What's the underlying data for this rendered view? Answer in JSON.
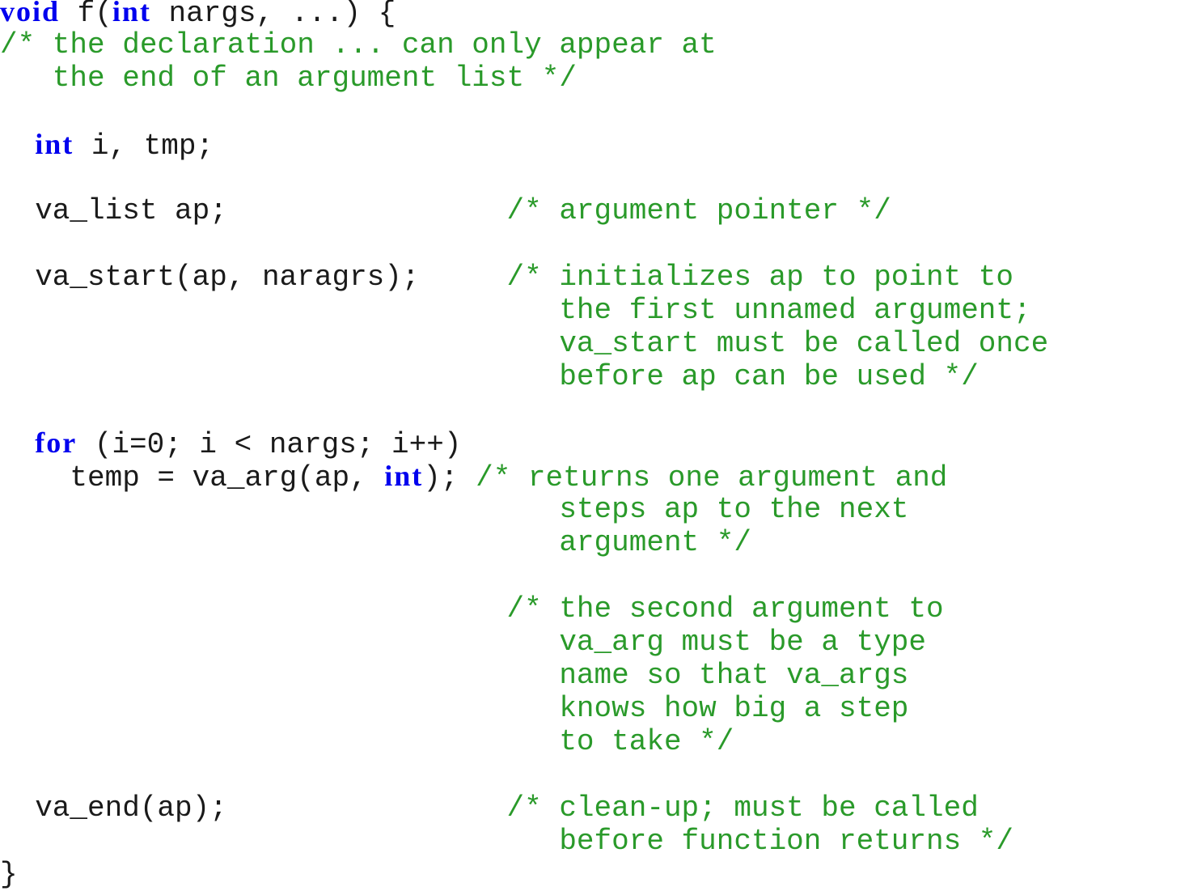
{
  "colors": {
    "keyword": "#0000ee",
    "comment": "#2a9a2a",
    "text": "#1a1a1a",
    "background": "#ffffff"
  },
  "lines": [
    [
      {
        "t": "kw",
        "v": "void"
      },
      {
        "t": "tx",
        "v": " f("
      },
      {
        "t": "kw",
        "v": "int"
      },
      {
        "t": "tx",
        "v": " nargs, ...) {"
      }
    ],
    [
      {
        "t": "cm",
        "v": "/* the declaration ... can only appear at"
      }
    ],
    [
      {
        "t": "cm",
        "v": "   the end of an argument list */"
      }
    ],
    [],
    [
      {
        "t": "tx",
        "v": "  "
      },
      {
        "t": "kw",
        "v": "int"
      },
      {
        "t": "tx",
        "v": " i, tmp;"
      }
    ],
    [],
    [
      {
        "t": "tx",
        "v": "  va_list ap;                "
      },
      {
        "t": "cm",
        "v": "/* argument pointer */"
      }
    ],
    [],
    [
      {
        "t": "tx",
        "v": "  va_start(ap, naragrs);     "
      },
      {
        "t": "cm",
        "v": "/* initializes ap to point to"
      }
    ],
    [
      {
        "t": "tx",
        "v": "                             "
      },
      {
        "t": "cm",
        "v": "   the first unnamed argument;"
      }
    ],
    [
      {
        "t": "tx",
        "v": "                             "
      },
      {
        "t": "cm",
        "v": "   va_start must be called once"
      }
    ],
    [
      {
        "t": "tx",
        "v": "                             "
      },
      {
        "t": "cm",
        "v": "   before ap can be used */"
      }
    ],
    [],
    [
      {
        "t": "tx",
        "v": "  "
      },
      {
        "t": "kw",
        "v": "for"
      },
      {
        "t": "tx",
        "v": " (i=0; i < nargs; i++)"
      }
    ],
    [
      {
        "t": "tx",
        "v": "    temp = va_arg(ap, "
      },
      {
        "t": "kw",
        "v": "int"
      },
      {
        "t": "tx",
        "v": "); "
      },
      {
        "t": "cm",
        "v": "/* returns one argument and"
      }
    ],
    [
      {
        "t": "tx",
        "v": "                             "
      },
      {
        "t": "cm",
        "v": "   steps ap to the next"
      }
    ],
    [
      {
        "t": "tx",
        "v": "                             "
      },
      {
        "t": "cm",
        "v": "   argument */"
      }
    ],
    [],
    [
      {
        "t": "tx",
        "v": "                             "
      },
      {
        "t": "cm",
        "v": "/* the second argument to"
      }
    ],
    [
      {
        "t": "tx",
        "v": "                             "
      },
      {
        "t": "cm",
        "v": "   va_arg must be a type"
      }
    ],
    [
      {
        "t": "tx",
        "v": "                             "
      },
      {
        "t": "cm",
        "v": "   name so that va_args"
      }
    ],
    [
      {
        "t": "tx",
        "v": "                             "
      },
      {
        "t": "cm",
        "v": "   knows how big a step"
      }
    ],
    [
      {
        "t": "tx",
        "v": "                             "
      },
      {
        "t": "cm",
        "v": "   to take */"
      }
    ],
    [],
    [
      {
        "t": "tx",
        "v": "  va_end(ap);                "
      },
      {
        "t": "cm",
        "v": "/* clean-up; must be called"
      }
    ],
    [
      {
        "t": "tx",
        "v": "                             "
      },
      {
        "t": "cm",
        "v": "   before function returns */"
      }
    ],
    [
      {
        "t": "tx",
        "v": "}"
      }
    ]
  ]
}
